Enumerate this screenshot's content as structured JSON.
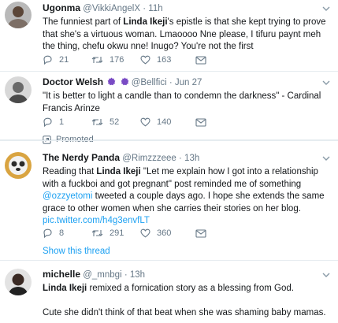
{
  "tweets": [
    {
      "display_name": "Ugonma",
      "handle": "@VikkiAngelX",
      "time": "11h",
      "text_parts": {
        "a": "The funniest part of ",
        "b": "Linda Ikeji",
        "c": "'s epistle is that she kept trying to prove that she's a virtuous woman. Lmaoooo Nne please, I tifuru paynt meh the thing, chefu okwu nne! Inugo? You're not the first"
      },
      "replies": "21",
      "retweets": "176",
      "likes": "163"
    },
    {
      "display_name": "Doctor Welsh",
      "handle": "@Bellfici",
      "time": "Jun 27",
      "text": "\"It is better to light a candle than to condemn the darkness\" - Cardinal Francis Arinze",
      "replies": "1",
      "retweets": "52",
      "likes": "140",
      "promoted_label": "Promoted"
    },
    {
      "display_name": "The Nerdy Panda",
      "handle": "@Rimzzzeee",
      "time": "13h",
      "text_parts": {
        "a": "Reading that ",
        "b": "Linda Ikeji",
        "c": " \"Let me explain how I got into a relationship with a fuckboi and got pregnant\" post reminded me of something ",
        "mention": "@ozzyetomi",
        "d": " tweeted a couple days ago. I hope she extends the same grace to other women when she carries their stories on her blog. ",
        "link": "pic.twitter.com/h4g3envfLT"
      },
      "replies": "8",
      "retweets": "291",
      "likes": "360",
      "show_thread": "Show this thread"
    },
    {
      "display_name": "michelle",
      "handle": "@_mnbgi",
      "time": "13h",
      "line1_bold": "Linda Ikeji",
      "line1_rest": " remixed a fornication story as a blessing from God.",
      "line2": "Cute she didn't think of that beat when she was shaming baby mamas."
    }
  ],
  "colors": {
    "text": "#14171a",
    "muted": "#657786",
    "link": "#1da1f2",
    "divider": "#e6ecf0",
    "badge": "#794bc4"
  },
  "icons": [
    "reply-icon",
    "retweet-icon",
    "like-icon",
    "dm-icon",
    "chevron-down-icon",
    "promoted-icon",
    "verified-badge-icon"
  ]
}
